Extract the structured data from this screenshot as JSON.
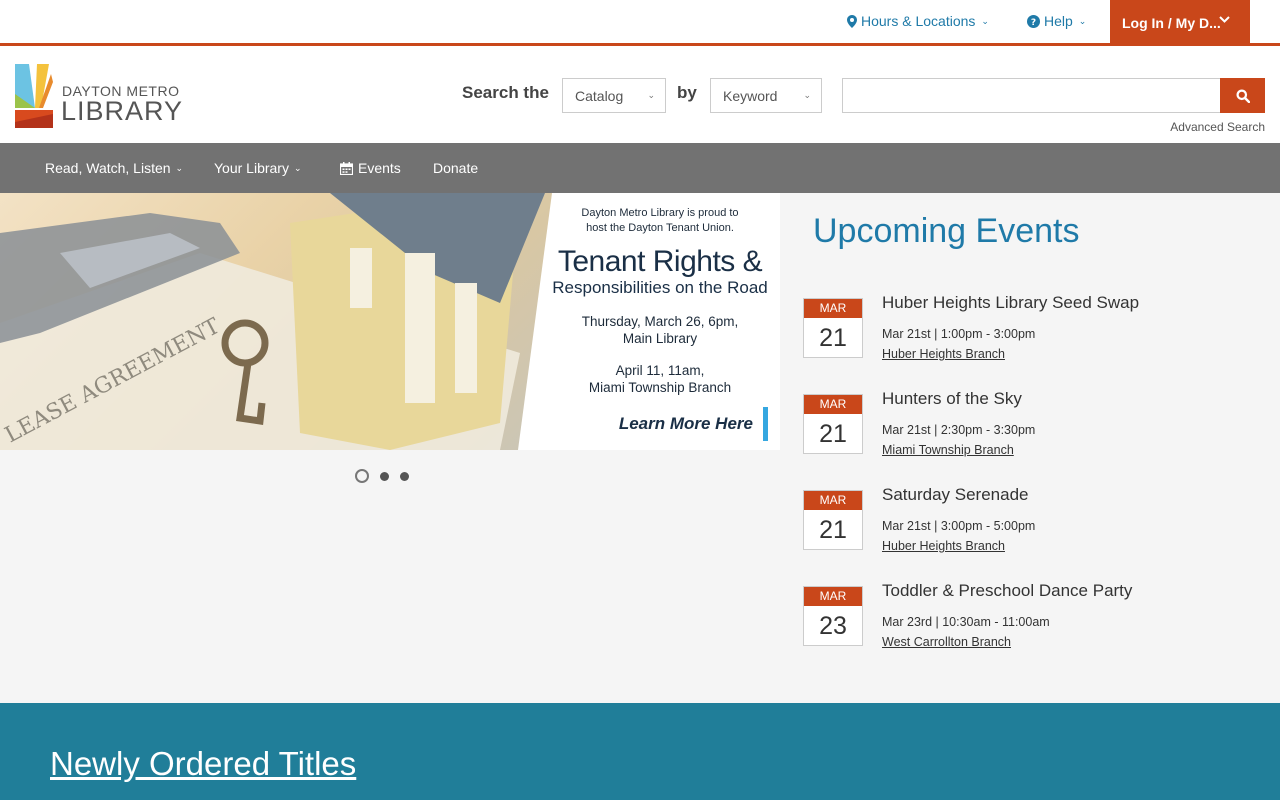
{
  "topbar": {
    "hours_label": "Hours & Locations",
    "help_label": "Help",
    "login_label": "Log In / My D..."
  },
  "logo": {
    "line1": "DAYTON METRO",
    "line2": "LIBRARY"
  },
  "search": {
    "label_prefix": "Search the",
    "scope_value": "Catalog",
    "label_by": "by",
    "field_value": "Keyword",
    "query_value": "",
    "advanced_label": "Advanced Search"
  },
  "nav": {
    "items": [
      {
        "label": "Read, Watch, Listen"
      },
      {
        "label": "Your Library"
      },
      {
        "label": "Events"
      },
      {
        "label": "Donate"
      }
    ]
  },
  "hero": {
    "intro_line1": "Dayton Metro Library is proud to",
    "intro_line2": "host the Dayton Tenant Union.",
    "title": "Tenant Rights &",
    "subtitle": "Responsibilities on the Road",
    "date1_line1": "Thursday, March 26, 6pm,",
    "date1_line2": "Main Library",
    "date2_line1": "April 11, 11am,",
    "date2_line2": "Miami Township Branch",
    "link_label": "Learn More Here",
    "slide_count": 3,
    "active_slide": 1
  },
  "events": {
    "title": "Upcoming Events",
    "items": [
      {
        "month": "MAR",
        "day": "21",
        "title": "Huber Heights Library Seed Swap",
        "time": "Mar 21st | 1:00pm - 3:00pm",
        "location": "Huber Heights Branch"
      },
      {
        "month": "MAR",
        "day": "21",
        "title": "Hunters of the Sky",
        "time": "Mar 21st | 2:30pm - 3:30pm",
        "location": "Miami Township Branch"
      },
      {
        "month": "MAR",
        "day": "21",
        "title": "Saturday Serenade",
        "time": "Mar 21st | 3:00pm - 5:00pm",
        "location": "Huber Heights Branch"
      },
      {
        "month": "MAR",
        "day": "23",
        "title": "Toddler & Preschool Dance Party",
        "time": "Mar 23rd | 10:30am - 11:00am",
        "location": "West Carrollton Branch"
      }
    ]
  },
  "newly_ordered": {
    "title": "Newly Ordered Titles"
  },
  "colors": {
    "accent_orange": "#c9471a",
    "link_blue": "#1f7aa8",
    "nav_gray": "#727272",
    "band_teal": "#207e99"
  }
}
